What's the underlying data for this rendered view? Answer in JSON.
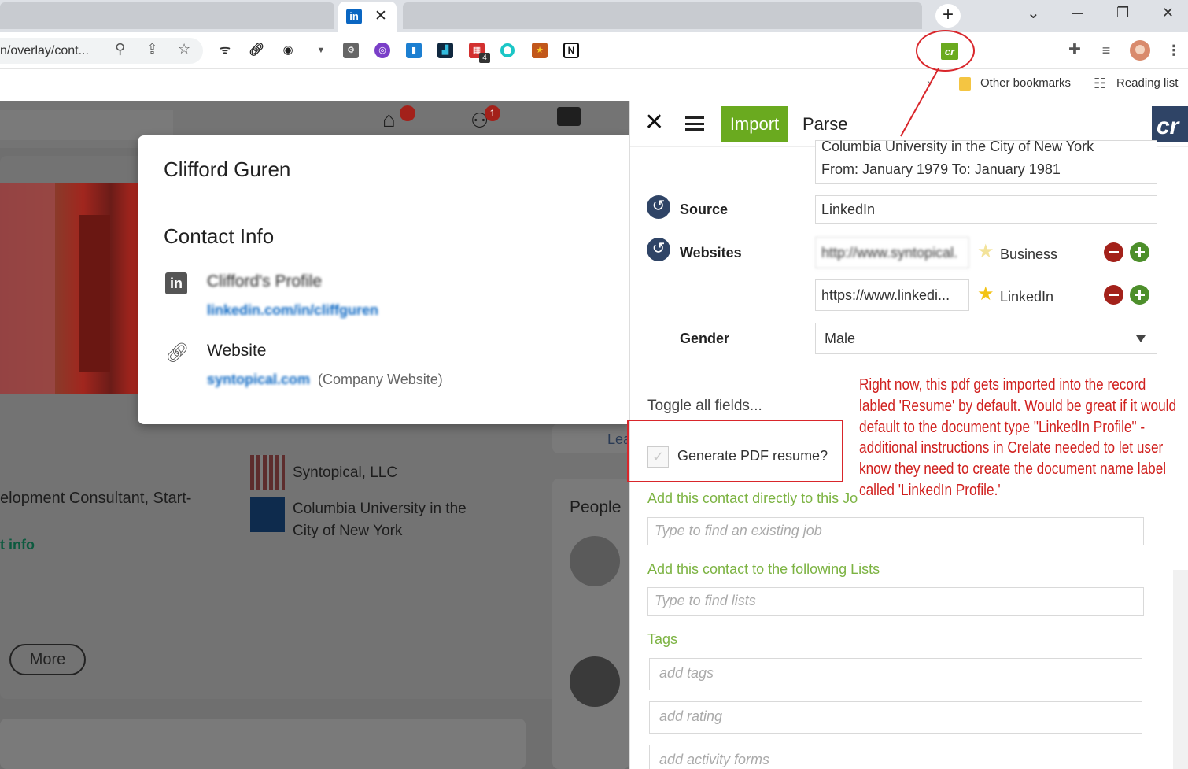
{
  "browser": {
    "tab_icon_label": "in",
    "tab_close": "✕",
    "new_tab": "+",
    "window_controls": {
      "dropdown": "⌄",
      "minimize": "—",
      "maximize": "❐",
      "close": "✕"
    },
    "url": "n/overlay/cont...",
    "crelate_extension_label": "cr",
    "extension_badge": "4",
    "bookmarks": {
      "other": "Other bookmarks",
      "reading": "Reading list"
    }
  },
  "linkedin": {
    "nav_badges": {
      "home": "",
      "network": "1"
    },
    "modal": {
      "name": "Clifford Guren",
      "section_title": "Contact Info",
      "profile_label": "Clifford's Profile",
      "profile_link": "linkedin.com/in/cliffguren",
      "website_label": "Website",
      "website_link": "syntopical.com",
      "website_note": "(Company Website)"
    },
    "background": {
      "headline_fragment": "elopment Consultant, Start-",
      "contact_info_fragment": "t info",
      "more_button": "More",
      "company1": "Syntopical, LLC",
      "school_line1": "Columbia University in the",
      "school_line2": "City of New York",
      "people_heading": "People",
      "learn_fragment": "Lea"
    }
  },
  "crelate": {
    "header": {
      "close": "✕",
      "tab_import": "Import",
      "tab_parse": "Parse",
      "logo": "cr"
    },
    "education": {
      "line1": "Columbia University in the City of New York",
      "line2": "From: January 1979 To: January 1981"
    },
    "source": {
      "label": "Source",
      "value": "LinkedIn"
    },
    "websites": {
      "label": "Websites",
      "items": [
        {
          "url": "http://www.syntopical.",
          "type": "Business"
        },
        {
          "url": "https://www.linkedi...",
          "type": "LinkedIn"
        }
      ]
    },
    "gender": {
      "label": "Gender",
      "value": "Male"
    },
    "toggle_all": "Toggle all fields...",
    "generate_pdf": {
      "label": "Generate PDF resume?",
      "check": "✓"
    },
    "job": {
      "label": "Add this contact directly to this Jo",
      "placeholder": "Type to find an existing job"
    },
    "lists": {
      "label": "Add this contact to the following Lists",
      "placeholder": "Type to find lists"
    },
    "tags": {
      "label": "Tags",
      "tags_placeholder": "add tags",
      "rating_placeholder": "add rating",
      "activity_placeholder": "add activity forms"
    }
  },
  "annotation": {
    "note": "Right now, this pdf gets imported into the record labled 'Resume' by default. Would be great if it would default to the document type \"LinkedIn Profile\" - additional instructions in Crelate needed to let user know they need to create the document name label called 'LinkedIn Profile.'"
  },
  "colors": {
    "crelate_green": "#6aaa1f",
    "crelate_navy": "#2f4466",
    "annotation_red": "#d9262b",
    "linkedin_blue": "#0a66c2"
  }
}
